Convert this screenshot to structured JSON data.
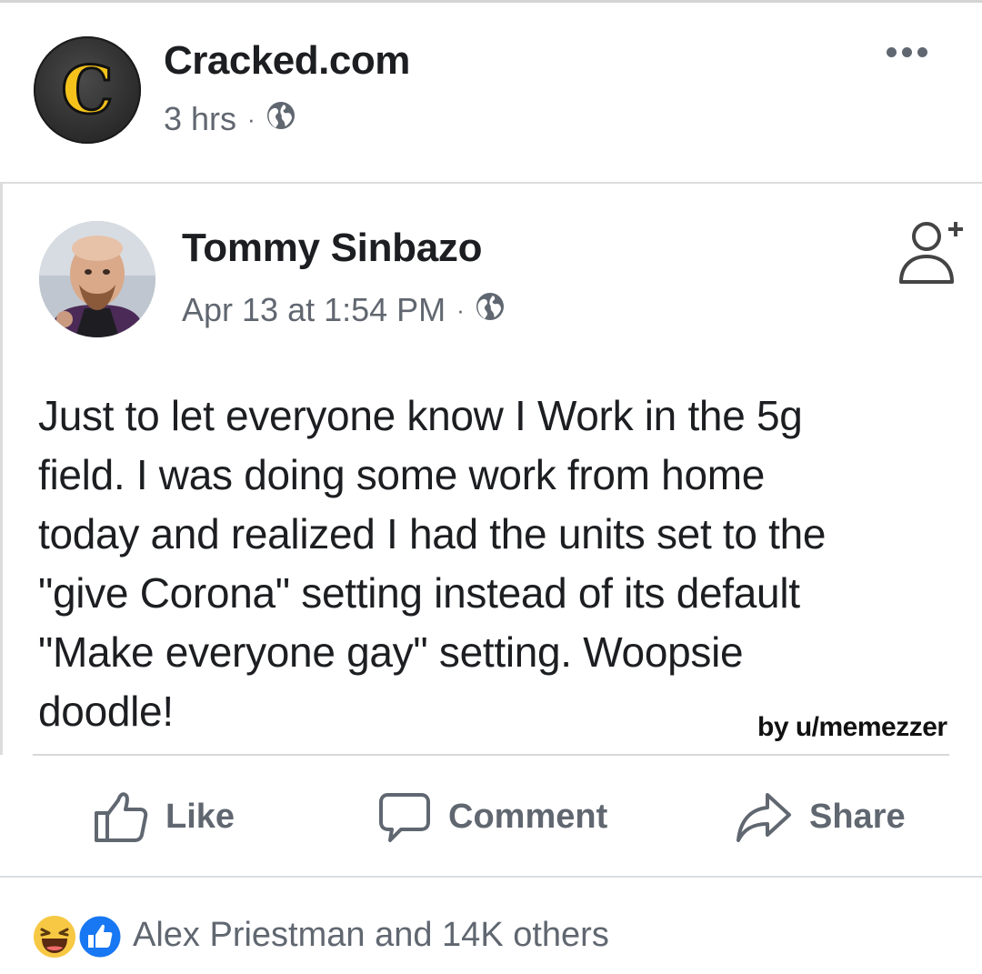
{
  "post": {
    "page_name": "Cracked.com",
    "time": "3 hrs",
    "avatar_letter": "C",
    "separator": "·"
  },
  "shared": {
    "author": "Tommy Sinbazo",
    "date": "Apr 13 at 1:54 PM",
    "separator": "·",
    "lines": [
      "Just to let everyone know I Work in the 5g",
      "field. I was doing some work from home",
      "today and realized I had the units set to the",
      "\"give Corona\" setting instead of its default",
      "\"Make everyone gay\" setting. Woopsie",
      "doodle!"
    ],
    "credit": "by u/memezzer"
  },
  "actions": {
    "like": "Like",
    "comment": "Comment",
    "share": "Share"
  },
  "reactions": {
    "text": "Alex Priestman and 14K others"
  },
  "colors": {
    "text_primary": "#1c1e21",
    "text_secondary": "#606770",
    "like_blue": "#1877f2",
    "haha_yellow": "#f7c843",
    "cracked_yellow": "#f4c21b"
  }
}
